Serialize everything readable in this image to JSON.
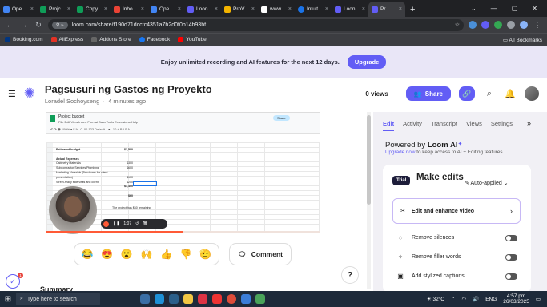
{
  "browser": {
    "tabs": [
      {
        "label": "Ope",
        "color": "#4285f4"
      },
      {
        "label": "Projc",
        "color": "#0f9d58"
      },
      {
        "label": "Copy",
        "color": "#0f9d58"
      },
      {
        "label": "Inbo",
        "color": "#ea4335"
      },
      {
        "label": "Ope",
        "color": "#4285f4"
      },
      {
        "label": "Loon",
        "color": "#625df5"
      },
      {
        "label": "ProV",
        "color": "#f4b400"
      },
      {
        "label": "www",
        "color": "#ffffff"
      },
      {
        "label": "Intuit",
        "color": "#1a73e8"
      },
      {
        "label": "Loon",
        "color": "#625df5"
      },
      {
        "label": "Pr",
        "color": "#625df5",
        "active": true
      }
    ],
    "new_tab": "+",
    "url": "loom.com/share/f190d71dccfc4351a7b2d0f0b14b93bf",
    "bookmarks": [
      {
        "label": "Booking.com",
        "color": "#003580"
      },
      {
        "label": "AliExpress",
        "color": "#e43225"
      },
      {
        "label": "Addons Store",
        "color": "#444"
      },
      {
        "label": "Facebook",
        "color": "#1877f2"
      },
      {
        "label": "YouTube",
        "color": "#ff0000"
      }
    ],
    "all_bookmarks": "All Bookmarks"
  },
  "banner": {
    "text": "Enjoy unlimited recording and AI features for the next 12 days.",
    "button": "Upgrade"
  },
  "video_header": {
    "title": "Pagsusuri ng Gastos ng Proyekto",
    "author": "Loradel Sochoyseng",
    "time": "4 minutes ago",
    "views": "0 views",
    "share": "Share"
  },
  "sheet": {
    "title": "Project budget",
    "menu": "File  Edit  View  Insert  Format  Data  Tools  Extensions  Help",
    "toolbar": "↶ ↷ 🖶  100% ▾  $ % .0 .00 123  Default... ▾  -  10  +  B I S A",
    "share": "Share",
    "rows": [
      "Estimated budget",
      "",
      "Actual Expenses",
      "Cabinetry Materials",
      "Subcontractor Services/Plumbing",
      "Marketing Materials (Brochures for client",
      "presentation)",
      "Street-ready side visits and client",
      "",
      "",
      ""
    ],
    "values": [
      "$1,500",
      "",
      "",
      "$300",
      "$600",
      "",
      "$100",
      "$250",
      "$1,400",
      "",
      "$60"
    ],
    "remaining": "The project has $60 remaining"
  },
  "player": {
    "time": "1:07"
  },
  "reactions": [
    "😂",
    "😍",
    "😮",
    "🙌",
    "👍",
    "👎",
    "🫡"
  ],
  "comment": "Comment",
  "help": "?",
  "summary": "Summary",
  "badge": "1",
  "panel": {
    "tabs": [
      "Edit",
      "Activity",
      "Transcript",
      "Views",
      "Settings"
    ],
    "powered_prefix": "Powered by ",
    "powered_brand": "Loom AI",
    "upgrade_link": "Upgrade now",
    "upgrade_rest": " to keep access to AI + Editing features",
    "trial": "Trial",
    "make": "Make edits",
    "auto": "Auto-applied",
    "edit_btn": "Edit and enhance video",
    "options": [
      "Remove silences",
      "Remove filler words",
      "Add stylized captions"
    ]
  },
  "taskbar": {
    "search": "Type here to search",
    "temp": "32°C",
    "lang": "ENG",
    "time": "4:57 pm",
    "date": "26/03/2025"
  }
}
